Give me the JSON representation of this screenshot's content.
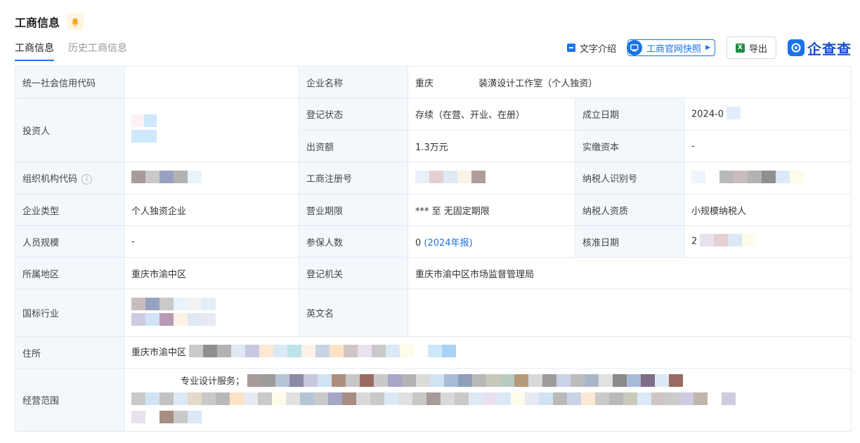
{
  "header": {
    "title": "工商信息"
  },
  "tabs": [
    {
      "label": "工商信息",
      "active": true
    },
    {
      "label": "历史工商信息",
      "active": false
    }
  ],
  "toolbar": {
    "text_intro": "文字介绍",
    "snapshot": "工商官网快照",
    "export": "导出",
    "brand": "企查查"
  },
  "labels": {
    "credit_code": "统一社会信用代码",
    "company_name": "企业名称",
    "investor": "投资人",
    "reg_status": "登记状态",
    "founded": "成立日期",
    "contribution": "出资额",
    "paid_capital": "实缴资本",
    "org_code": "组织机构代码",
    "reg_number": "工商注册号",
    "taxpayer_id": "纳税人识别号",
    "company_type": "企业类型",
    "business_term": "营业期限",
    "taxpayer_qual": "纳税人资质",
    "staff_size": "人员规模",
    "insured": "参保人数",
    "approval_date": "核准日期",
    "region": "所属地区",
    "reg_authority": "登记机关",
    "industry": "国标行业",
    "english_name": "英文名",
    "address": "住所",
    "scope": "经营范围"
  },
  "values": {
    "company_name_a": "重庆",
    "company_name_b": "装潢设计工作室（个人独资）",
    "reg_status": "存续（在营、开业、在册）",
    "founded": "2024-0",
    "contribution": "1.3万元",
    "paid_capital": "-",
    "company_type": "个人独资企业",
    "business_term": "*** 至 无固定期限",
    "taxpayer_qual": "小规模纳税人",
    "staff_size": "-",
    "insured_count": "0",
    "insured_report": "(2024年报)",
    "approval_date": "2",
    "region": "重庆市渝中区",
    "reg_authority": "重庆市渝中区市场监督管理局",
    "address": "重庆市渝中区",
    "scope": "专业设计服务；"
  },
  "colors": {
    "accent": "#1a73e8",
    "label_bg": "#f3f8fd",
    "border": "#e4eaf2"
  }
}
